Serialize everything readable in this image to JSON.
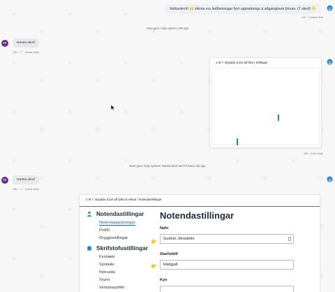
{
  "bot_message": "Velkomin/n! 🙌 Hérna eru leiðbeiningar fyrir uppsetningu á aðganginum þínum. (7 skref) 👇",
  "meta_bot_1": "13h · Custom Bot",
  "system_1": "Kara gave reply options 13h ago",
  "user_initials_1": "FF",
  "user_reply_1": "Næsta skref",
  "meta_user_1": "13h · ⓘ · Quick reply",
  "small_card_caption": "1 af 7. Byrjaðu á því að fara í Stillingar",
  "meta_bot_2": "13h · Auto reply",
  "system_2": "Kara gave reply options: Næsta skref and Til baka 13h ago",
  "user_initials_2": "FF",
  "user_reply_2": "Næsta skref",
  "meta_user_2": "13h · ⓘ · Quick reply",
  "big_card": {
    "caption": "2 af 7. Byrjaðu á því að fylla út reitina í Notendastillingar",
    "sidebar": {
      "section1_title": "Notendastillingar",
      "section1_items": [
        "Notendaupplýsingar",
        "Prófíll",
        "Öryggisstillingar"
      ],
      "section2_title": "Skrifstofustillingar",
      "section2_items": [
        "Fyrirtæki",
        "Sýnileiki",
        "Þjónusta",
        "Teymi",
        "Verkstrasyfirlit"
      ]
    },
    "form": {
      "title": "Notendastillingar",
      "name_label": "Nafn",
      "name_value": "Guðrún Jónsdóttir",
      "title_label": "Starfstitill",
      "title_value": "Ráðgjafi",
      "gender_label": "Kyn"
    }
  },
  "colors": {
    "accent": "#2a7ec8",
    "user_avatar": "#6a2f86",
    "highlight_hand": "#f0a21a"
  }
}
